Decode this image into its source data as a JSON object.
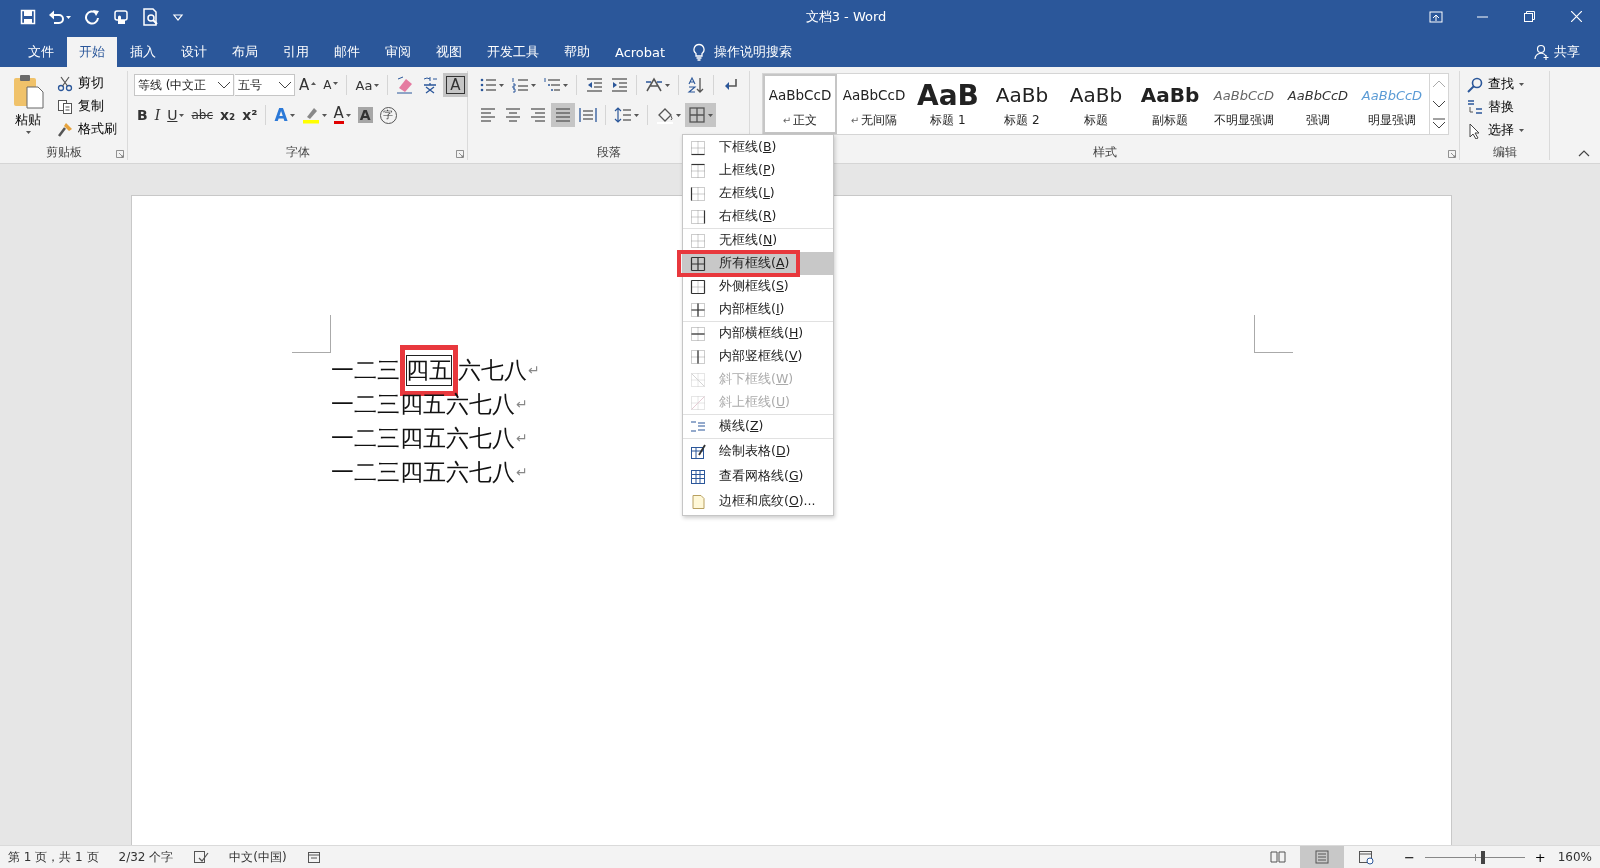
{
  "window": {
    "title": "文档3 - Word"
  },
  "tabs": [
    {
      "label": "文件",
      "selected": false
    },
    {
      "label": "开始",
      "selected": true
    },
    {
      "label": "插入",
      "selected": false
    },
    {
      "label": "设计",
      "selected": false
    },
    {
      "label": "布局",
      "selected": false
    },
    {
      "label": "引用",
      "selected": false
    },
    {
      "label": "邮件",
      "selected": false
    },
    {
      "label": "审阅",
      "selected": false
    },
    {
      "label": "视图",
      "selected": false
    },
    {
      "label": "开发工具",
      "selected": false
    },
    {
      "label": "帮助",
      "selected": false
    },
    {
      "label": "Acrobat",
      "selected": false
    }
  ],
  "tell_me": {
    "label": "操作说明搜索"
  },
  "share": {
    "label": "共享"
  },
  "clipboard": {
    "label": "剪贴板",
    "paste": "粘贴",
    "actions": [
      "剪切",
      "复制",
      "格式刷"
    ]
  },
  "font": {
    "label": "字体",
    "font_name": "等线 (中文正",
    "font_size": "五号",
    "row1": [
      {
        "kind": "grow",
        "label": "A",
        "dropdown": false,
        "pressed": false
      },
      {
        "kind": "shrink",
        "label": "A",
        "dropdown": false,
        "pressed": false
      },
      {
        "kind": "case",
        "label": "Aa",
        "dropdown": true,
        "pressed": false
      },
      {
        "kind": "clear",
        "dropdown": false,
        "pressed": false
      },
      {
        "kind": "phonetic",
        "dropdown": false,
        "pressed": false
      },
      {
        "kind": "border",
        "label": "A",
        "dropdown": false,
        "pressed": true
      }
    ],
    "row2": [
      {
        "kind": "bold",
        "label": "B",
        "dropdown": false,
        "pressed": false
      },
      {
        "kind": "italic",
        "label": "I",
        "dropdown": false,
        "pressed": false
      },
      {
        "kind": "underline",
        "label": "U",
        "dropdown": true,
        "pressed": false
      },
      {
        "kind": "strike",
        "label": "abc",
        "dropdown": false,
        "pressed": false
      },
      {
        "kind": "sub",
        "label": "x₂",
        "dropdown": false,
        "pressed": false
      },
      {
        "kind": "sup",
        "label": "x²",
        "dropdown": false,
        "pressed": false
      },
      {
        "kind": "effects",
        "label": "A",
        "dropdown": true,
        "pressed": false
      },
      {
        "kind": "highlight",
        "dropdown": true,
        "pressed": false
      },
      {
        "kind": "color",
        "label": "A",
        "dropdown": true,
        "pressed": false
      },
      {
        "kind": "shading",
        "label": "A",
        "dropdown": false,
        "pressed": false
      },
      {
        "kind": "enclose",
        "label": "字",
        "dropdown": false,
        "pressed": false
      }
    ]
  },
  "paragraph": {
    "label": "段落",
    "row1": [
      {
        "dropdown": true,
        "pressed": false
      },
      {
        "dropdown": true,
        "pressed": false
      },
      {
        "dropdown": true,
        "pressed": false
      },
      {
        "dropdown": false,
        "pressed": false
      },
      {
        "dropdown": false,
        "pressed": false
      },
      {
        "dropdown": true,
        "pressed": false
      },
      {
        "dropdown": false,
        "pressed": false
      },
      {
        "dropdown": false,
        "pressed": false
      }
    ],
    "row2": [
      {
        "dropdown": false,
        "pressed": false
      },
      {
        "dropdown": false,
        "pressed": false
      },
      {
        "dropdown": false,
        "pressed": false
      },
      {
        "dropdown": false,
        "pressed": true
      },
      {
        "dropdown": false,
        "pressed": false
      },
      {
        "dropdown": true,
        "pressed": false
      },
      {
        "dropdown": true,
        "pressed": false
      },
      {
        "dropdown": true,
        "pressed": true
      }
    ]
  },
  "styles": {
    "label": "样式",
    "items": [
      {
        "kind": "normal",
        "preview": "AaBbCcD",
        "name": "正文",
        "mark": "↵",
        "selected": true
      },
      {
        "kind": "normal",
        "preview": "AaBbCcD",
        "name": "无间隔",
        "mark": "↵",
        "selected": false
      },
      {
        "kind": "heading1",
        "preview": "AaB",
        "name": "标题 1",
        "selected": false
      },
      {
        "kind": "heading2",
        "preview": "AaBb",
        "name": "标题 2",
        "selected": false
      },
      {
        "kind": "title",
        "preview": "AaBb",
        "name": "标题",
        "selected": false
      },
      {
        "kind": "subtitle",
        "preview": "AaBb",
        "name": "副标题",
        "selected": false
      },
      {
        "kind": "subtle",
        "preview": "AaBbCcD",
        "name": "不明显强调",
        "selected": false
      },
      {
        "kind": "emphasis",
        "preview": "AaBbCcD",
        "name": "强调",
        "selected": false
      },
      {
        "kind": "intense",
        "preview": "AaBbCcD",
        "name": "明显强调",
        "selected": false
      }
    ]
  },
  "editing": {
    "label": "编辑",
    "actions": [
      {
        "label": "查找",
        "dropdown": true
      },
      {
        "label": "替换",
        "dropdown": false
      },
      {
        "label": "选择",
        "dropdown": true
      }
    ]
  },
  "document": {
    "lines": [
      {
        "segments": [
          {
            "text": "一二三",
            "bordered": false,
            "annotated": false
          },
          {
            "text": "四五",
            "bordered": true,
            "annotated": true
          },
          {
            "text": "六七八",
            "bordered": false,
            "annotated": false
          }
        ],
        "end_mark": "↵"
      },
      {
        "segments": [
          {
            "text": "一二三四五六七八",
            "bordered": false,
            "annotated": false
          }
        ],
        "end_mark": "↵"
      },
      {
        "segments": [
          {
            "text": "一二三四五六七八",
            "bordered": false,
            "annotated": false
          }
        ],
        "end_mark": "↵"
      },
      {
        "segments": [
          {
            "text": "一二三四五六七八",
            "bordered": false,
            "annotated": false
          }
        ],
        "end_mark": "↵"
      }
    ]
  },
  "borders_menu": {
    "items": [
      {
        "kind": "bottom",
        "label": "下框线(",
        "key": "B",
        "end": ")",
        "selected": false,
        "disabled": false,
        "annotated": false,
        "separator_after": false
      },
      {
        "kind": "top",
        "label": "上框线(",
        "key": "P",
        "end": ")",
        "selected": false,
        "disabled": false,
        "annotated": false,
        "separator_after": false
      },
      {
        "kind": "left",
        "label": "左框线(",
        "key": "L",
        "end": ")",
        "selected": false,
        "disabled": false,
        "annotated": false,
        "separator_after": false
      },
      {
        "kind": "right",
        "label": "右框线(",
        "key": "R",
        "end": ")",
        "selected": false,
        "disabled": false,
        "annotated": false,
        "separator_after": true
      },
      {
        "kind": "none",
        "label": "无框线(",
        "key": "N",
        "end": ")",
        "selected": false,
        "disabled": false,
        "annotated": false,
        "separator_after": false
      },
      {
        "kind": "all",
        "label": "所有框线(",
        "key": "A",
        "end": ")",
        "selected": true,
        "disabled": false,
        "annotated": true,
        "separator_after": false
      },
      {
        "kind": "outside",
        "label": "外侧框线(",
        "key": "S",
        "end": ")",
        "selected": false,
        "disabled": false,
        "annotated": false,
        "separator_after": false
      },
      {
        "kind": "inside",
        "label": "内部框线(",
        "key": "I",
        "end": ")",
        "selected": false,
        "disabled": false,
        "annotated": false,
        "separator_after": true
      },
      {
        "kind": "inside_h",
        "label": "内部横框线(",
        "key": "H",
        "end": ")",
        "selected": false,
        "disabled": false,
        "annotated": false,
        "separator_after": false
      },
      {
        "kind": "inside_v",
        "label": "内部竖框线(",
        "key": "V",
        "end": ")",
        "selected": false,
        "disabled": false,
        "annotated": false,
        "separator_after": false
      },
      {
        "kind": "diag_down",
        "label": "斜下框线(",
        "key": "W",
        "end": ")",
        "selected": false,
        "disabled": true,
        "annotated": false,
        "separator_after": false
      },
      {
        "kind": "diag_up",
        "label": "斜上框线(",
        "key": "U",
        "end": ")",
        "selected": false,
        "disabled": true,
        "annotated": false,
        "separator_after": true
      },
      {
        "kind": "hline",
        "label": "横线(",
        "key": "Z",
        "end": ")",
        "selected": false,
        "disabled": false,
        "annotated": false,
        "separator_after": true
      },
      {
        "kind": "draw",
        "label": "绘制表格(",
        "key": "D",
        "end": ")",
        "selected": false,
        "disabled": false,
        "annotated": false,
        "separator_after": false
      },
      {
        "kind": "grid",
        "label": "查看网格线(",
        "key": "G",
        "end": ")",
        "selected": false,
        "disabled": false,
        "annotated": false,
        "separator_after": false
      },
      {
        "kind": "dialog",
        "label": "边框和底纹(",
        "key": "O",
        "end": ")...",
        "selected": false,
        "disabled": false,
        "annotated": false,
        "separator_after": false
      }
    ]
  },
  "status_bar": {
    "page": "第 1 页，共 1 页",
    "words": "2/32 个字",
    "language": "中文(中国)",
    "views": [
      {
        "selected": false
      },
      {
        "selected": true
      },
      {
        "selected": false
      }
    ],
    "zoom_out": "−",
    "zoom_in": "+",
    "zoom": {
      "level": 0.58
    },
    "zoom_text": "160%"
  }
}
